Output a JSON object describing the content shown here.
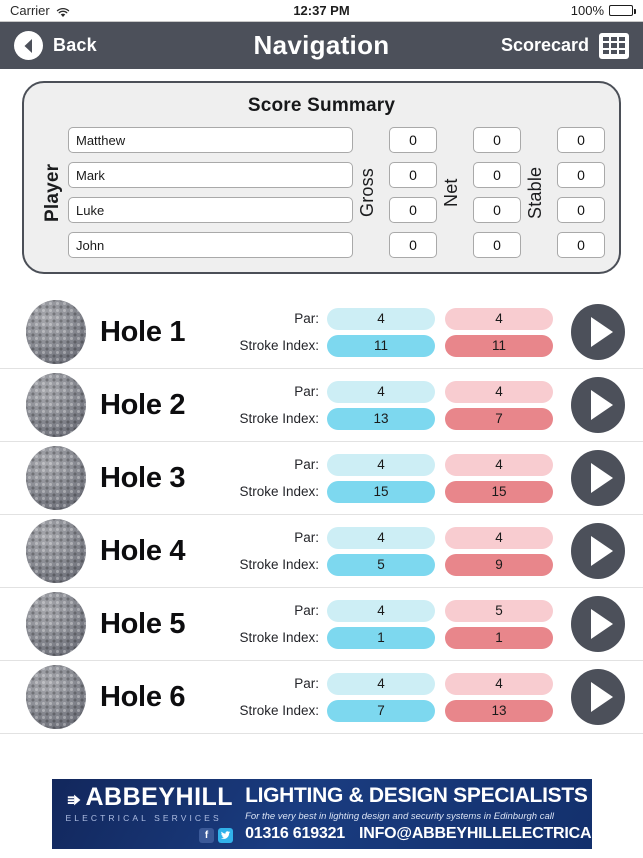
{
  "status_bar": {
    "carrier": "Carrier",
    "wifi_icon": "wifi-icon",
    "time": "12:37 PM",
    "battery_percent": "100%",
    "battery_level": 100
  },
  "nav_bar": {
    "back_label": "Back",
    "back_icon": "chevron-left-circle-icon",
    "title": "Navigation",
    "right_label": "Scorecard",
    "right_icon": "grid-icon",
    "background_color": "#4c505a"
  },
  "score_summary": {
    "title": "Score Summary",
    "player_label": "Player",
    "gross_label": "Gross",
    "net_label": "Net",
    "stable_label": "Stable",
    "players": [
      {
        "name": "Matthew",
        "gross": "0",
        "net": "0",
        "stable": "0"
      },
      {
        "name": "Mark",
        "gross": "0",
        "net": "0",
        "stable": "0"
      },
      {
        "name": "Luke",
        "gross": "0",
        "net": "0",
        "stable": "0"
      },
      {
        "name": "John",
        "gross": "0",
        "net": "0",
        "stable": "0"
      }
    ]
  },
  "holes_section": {
    "par_label": "Par:",
    "stroke_index_label": "Stroke Index:",
    "ball_icon": "golf-ball-icon",
    "play_icon": "play-arrow-icon",
    "colors": {
      "par_blue": "#cdeef5",
      "stroke_index_blue": "#7dd8ef",
      "par_pink": "#f8ccd0",
      "stroke_index_pink": "#e8868b"
    },
    "holes": [
      {
        "name": "Hole 1",
        "par_blue": "4",
        "si_blue": "11",
        "par_pink": "4",
        "si_pink": "11"
      },
      {
        "name": "Hole 2",
        "par_blue": "4",
        "si_blue": "13",
        "par_pink": "4",
        "si_pink": "7"
      },
      {
        "name": "Hole 3",
        "par_blue": "4",
        "si_blue": "15",
        "par_pink": "4",
        "si_pink": "15"
      },
      {
        "name": "Hole 4",
        "par_blue": "4",
        "si_blue": "5",
        "par_pink": "4",
        "si_pink": "9"
      },
      {
        "name": "Hole 5",
        "par_blue": "4",
        "si_blue": "1",
        "par_pink": "5",
        "si_pink": "1"
      },
      {
        "name": "Hole 6",
        "par_blue": "4",
        "si_blue": "7",
        "par_pink": "4",
        "si_pink": "13"
      }
    ]
  },
  "ad_banner": {
    "brand": "ABBEYHILL",
    "brand_sub": "ELECTRICAL SERVICES",
    "headline": "LIGHTING & DESIGN SPECIALISTS",
    "tagline": "For the very best in lighting design and security systems in Edinburgh call",
    "phone": "01316 619321",
    "email": "INFO@ABBEYHILLELECTRICAL.COM",
    "facebook_icon": "facebook-icon",
    "facebook_glyph": "f",
    "twitter_icon": "twitter-icon",
    "twitter_glyph": "t",
    "plug_icon": "plug-icon",
    "background_color": "#15306b"
  }
}
